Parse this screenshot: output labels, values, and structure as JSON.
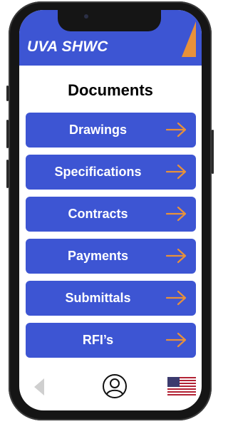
{
  "app": {
    "brand": "UVA SHWC"
  },
  "page": {
    "title": "Documents"
  },
  "menu": {
    "items": [
      {
        "label": "Drawings"
      },
      {
        "label": "Specifications"
      },
      {
        "label": "Contracts"
      },
      {
        "label": "Payments"
      },
      {
        "label": "Submittals"
      },
      {
        "label": "RFI’s"
      }
    ]
  },
  "nav": {
    "back_icon": "back-triangle-icon",
    "profile_icon": "user-profile-icon",
    "language_icon": "us-flag-icon"
  },
  "colors": {
    "primary": "#3d55d3",
    "accent": "#e8913a",
    "background": "#ffffff"
  }
}
